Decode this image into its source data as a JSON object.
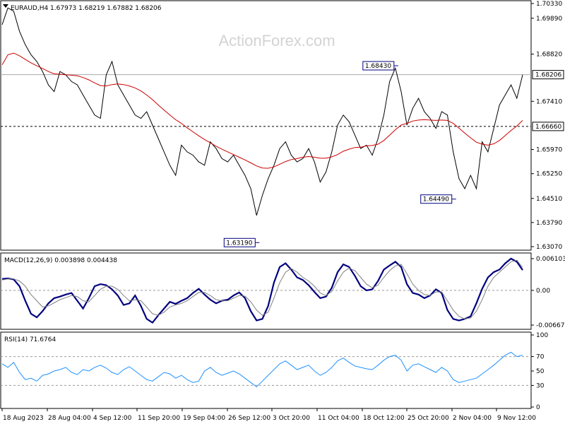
{
  "chart_data": [
    {
      "type": "line",
      "panel": "price",
      "title": "EURAUD,H4  1.67973  1.68219  1.67882  1.68206",
      "watermark": "ActionForex.com",
      "ylim": [
        1.6307,
        1.7033
      ],
      "y_ticks": [
        "1.70330",
        "1.69890",
        "1.68820",
        "1.67410",
        "1.65970",
        "1.65250",
        "1.64510",
        "1.63790",
        "1.63070"
      ],
      "current_price": "1.68206",
      "support_level": "1.66660",
      "annotations": [
        {
          "label": "1.68430",
          "x_index": 68,
          "value": 1.6843
        },
        {
          "label": "1.63190",
          "x_index": 44,
          "value": 1.6319
        },
        {
          "label": "1.64490",
          "x_index": 78,
          "value": 1.6449
        }
      ],
      "x_tick_labels": [
        "18 Aug 2023",
        "28 Aug 04:00",
        "4 Sep 12:00",
        "11 Sep 20:00",
        "19 Sep 04:00",
        "26 Sep 12:00",
        "3 Oct 20:00",
        "11 Oct 04:00",
        "18 Oct 12:00",
        "25 Oct 20:00",
        "2 Nov 04:00",
        "9 Nov 12:00"
      ],
      "series": [
        {
          "name": "",
          "color": "#000000",
          "values": [
            1.697,
            1.702,
            1.701,
            1.695,
            1.691,
            1.688,
            1.686,
            1.683,
            1.679,
            1.677,
            1.683,
            1.682,
            1.68,
            1.679,
            1.676,
            1.673,
            1.67,
            1.669,
            1.682,
            1.686,
            1.679,
            1.676,
            1.673,
            1.67,
            1.669,
            1.671,
            1.667,
            1.663,
            1.659,
            1.655,
            1.652,
            1.661,
            1.659,
            1.658,
            1.656,
            1.655,
            1.662,
            1.66,
            1.657,
            1.656,
            1.658,
            1.655,
            1.652,
            1.648,
            1.64,
            1.646,
            1.651,
            1.655,
            1.66,
            1.662,
            1.658,
            1.656,
            1.657,
            1.66,
            1.656,
            1.65,
            1.653,
            1.659,
            1.667,
            1.67,
            1.668,
            1.664,
            1.66,
            1.661,
            1.658,
            1.663,
            1.67,
            1.68,
            1.684,
            1.677,
            1.667,
            1.672,
            1.675,
            1.671,
            1.669,
            1.666,
            1.671,
            1.67,
            1.659,
            1.651,
            1.648,
            1.652,
            1.648,
            1.662,
            1.659,
            1.666,
            1.673,
            1.676,
            1.679,
            1.675,
            1.682
          ]
        },
        {
          "name": "",
          "color": "#cc0000",
          "values": [
            1.685,
            1.688,
            1.6885,
            1.6877,
            1.6866,
            1.6856,
            1.6847,
            1.6839,
            1.683,
            1.6823,
            1.6822,
            1.682,
            1.6819,
            1.6817,
            1.6812,
            1.6805,
            1.6796,
            1.6788,
            1.6787,
            1.6791,
            1.6793,
            1.6791,
            1.6787,
            1.6781,
            1.6772,
            1.676,
            1.6746,
            1.673,
            1.6715,
            1.67,
            1.6686,
            1.6675,
            1.6662,
            1.665,
            1.6638,
            1.6627,
            1.6617,
            1.6607,
            1.6598,
            1.659,
            1.6582,
            1.6574,
            1.6566,
            1.6557,
            1.6548,
            1.6542,
            1.6541,
            1.6545,
            1.6553,
            1.6561,
            1.6567,
            1.657,
            1.6574,
            1.6576,
            1.6574,
            1.6571,
            1.6571,
            1.6575,
            1.6582,
            1.6592,
            1.6598,
            1.6603,
            1.6604,
            1.6608,
            1.6609,
            1.6613,
            1.6624,
            1.664,
            1.6656,
            1.667,
            1.6675,
            1.6682,
            1.6685,
            1.6686,
            1.6685,
            1.6684,
            1.6685,
            1.6684,
            1.6675,
            1.6661,
            1.6646,
            1.6632,
            1.6619,
            1.6613,
            1.661,
            1.6614,
            1.6624,
            1.6639,
            1.6654,
            1.6667,
            1.6684
          ]
        }
      ]
    },
    {
      "type": "line",
      "panel": "macd",
      "title": "MACD(12,26,9) 0.003898 0.004438",
      "ylim": [
        -0.006679,
        0.006103
      ],
      "y_ticks": [
        "0.006103",
        "0.00",
        "-0.006679"
      ],
      "series": [
        {
          "name": "",
          "color": "#00007f",
          "values": [
            0.0022,
            0.0023,
            0.0021,
            0.0008,
            -0.002,
            -0.0045,
            -0.0052,
            -0.004,
            -0.0025,
            -0.0015,
            -0.0012,
            -0.0008,
            -0.0005,
            -0.002,
            -0.0035,
            -0.0015,
            0.0008,
            0.0012,
            0.001,
            0.0002,
            -0.001,
            -0.0028,
            -0.0025,
            -0.001,
            -0.003,
            -0.0055,
            -0.0062,
            -0.0048,
            -0.0035,
            -0.0022,
            -0.0026,
            -0.002,
            -0.0015,
            -0.0005,
            0.0003,
            -0.0008,
            -0.0018,
            -0.0025,
            -0.002,
            -0.0018,
            -0.001,
            -0.0004,
            -0.0015,
            -0.004,
            -0.0058,
            -0.0055,
            -0.003,
            0.0015,
            0.0045,
            0.0052,
            0.004,
            0.0025,
            0.002,
            0.001,
            -0.0003,
            -0.0015,
            -0.0012,
            0.0005,
            0.0035,
            0.005,
            0.0045,
            0.0028,
            0.0008,
            0.0,
            0.0002,
            0.0018,
            0.004,
            0.0048,
            0.0055,
            0.0045,
            0.0012,
            -0.0005,
            -0.0008,
            -0.0015,
            -0.001,
            0.0002,
            -0.0005,
            -0.0038,
            -0.0055,
            -0.0058,
            -0.0055,
            -0.005,
            -0.0025,
            0.0003,
            0.0025,
            0.0035,
            0.004,
            0.0052,
            0.0061,
            0.0055,
            0.0039
          ]
        },
        {
          "name": "",
          "color": "#808080",
          "values": [
            0.002,
            0.0022,
            0.0022,
            0.0018,
            0.0008,
            -0.0008,
            -0.002,
            -0.0032,
            -0.003,
            -0.0024,
            -0.0018,
            -0.0014,
            -0.001,
            -0.0012,
            -0.002,
            -0.0022,
            -0.001,
            0.0002,
            0.0008,
            0.0008,
            0.0002,
            -0.001,
            -0.002,
            -0.0018,
            -0.002,
            -0.0032,
            -0.0045,
            -0.0048,
            -0.0042,
            -0.0032,
            -0.0028,
            -0.0025,
            -0.002,
            -0.0012,
            -0.0004,
            -0.0004,
            -0.001,
            -0.0018,
            -0.002,
            -0.002,
            -0.0015,
            -0.001,
            -0.0011,
            -0.0022,
            -0.0038,
            -0.0048,
            -0.0042,
            -0.0015,
            0.0015,
            0.0035,
            0.0042,
            0.0035,
            0.0025,
            0.0018,
            0.0008,
            -0.0005,
            -0.001,
            -0.0002,
            0.0018,
            0.0035,
            0.0043,
            0.0038,
            0.0025,
            0.0012,
            0.0005,
            0.001,
            0.0025,
            0.0038,
            0.0047,
            0.005,
            0.0032,
            0.0012,
            0.0,
            -0.0008,
            -0.001,
            -0.0003,
            -0.0003,
            -0.002,
            -0.0038,
            -0.005,
            -0.0055,
            -0.0053,
            -0.004,
            -0.0018,
            0.0008,
            0.0025,
            0.0035,
            0.0045,
            0.0055,
            0.0058,
            0.0044
          ]
        }
      ]
    },
    {
      "type": "line",
      "panel": "rsi",
      "title": "RSI(14) 71.6764",
      "ylim": [
        0,
        100
      ],
      "y_ticks": [
        "100",
        "70",
        "50",
        "30",
        "0"
      ],
      "levels": [
        70,
        30
      ],
      "series": [
        {
          "name": "",
          "color": "#1e90ff",
          "values": [
            60,
            55,
            62,
            48,
            38,
            40,
            36,
            44,
            46,
            50,
            52,
            55,
            48,
            45,
            52,
            50,
            55,
            58,
            54,
            48,
            45,
            52,
            56,
            50,
            44,
            38,
            36,
            42,
            48,
            46,
            40,
            44,
            38,
            34,
            36,
            50,
            55,
            48,
            44,
            47,
            50,
            46,
            40,
            34,
            28,
            36,
            44,
            52,
            60,
            64,
            58,
            52,
            55,
            58,
            50,
            44,
            48,
            55,
            64,
            68,
            62,
            57,
            55,
            53,
            52,
            58,
            65,
            70,
            72,
            65,
            50,
            58,
            60,
            56,
            52,
            48,
            55,
            50,
            38,
            34,
            36,
            38,
            40,
            46,
            52,
            58,
            65,
            72,
            76,
            70,
            72
          ]
        }
      ]
    }
  ]
}
